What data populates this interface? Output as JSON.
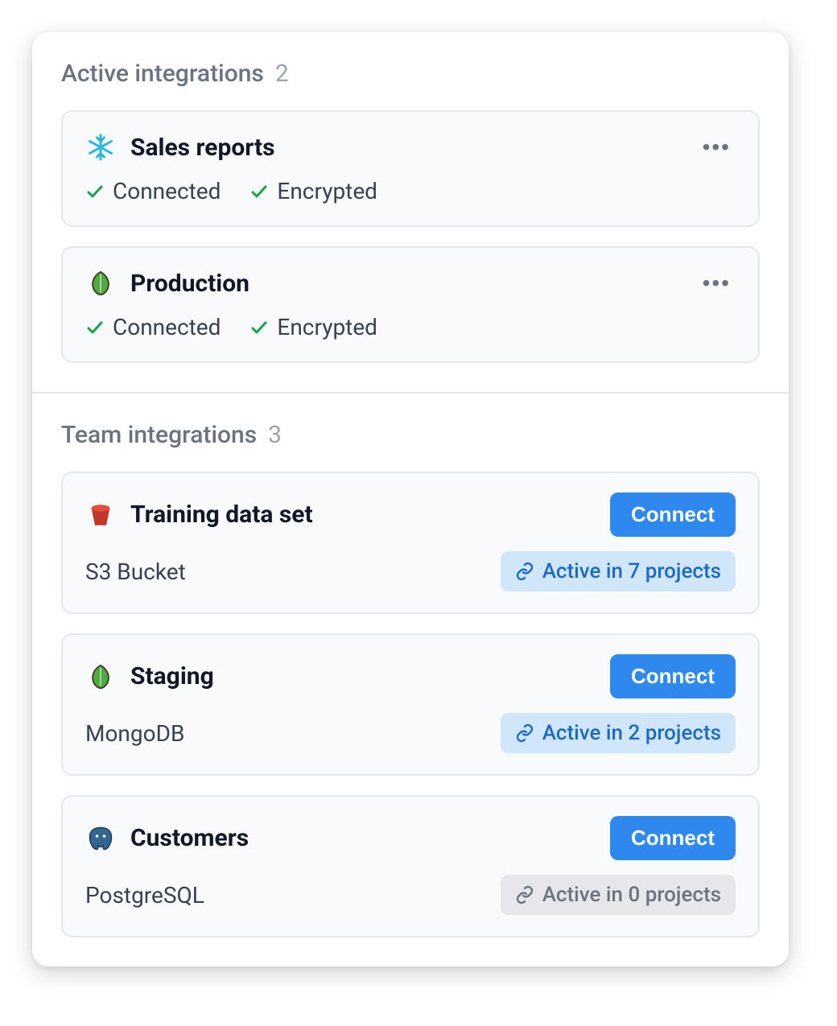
{
  "sections": {
    "active": {
      "title": "Active integrations",
      "count": "2",
      "items": [
        {
          "icon": "snowflake",
          "title": "Sales reports",
          "status1": "Connected",
          "status2": "Encrypted"
        },
        {
          "icon": "mongodb",
          "title": "Production",
          "status1": "Connected",
          "status2": "Encrypted"
        }
      ]
    },
    "team": {
      "title": "Team integrations",
      "count": "3",
      "items": [
        {
          "icon": "redshift",
          "title": "Training data set",
          "subtype": "S3 Bucket",
          "connect_label": "Connect",
          "badge_text": "Active in 7 projects",
          "badge_style": "blue"
        },
        {
          "icon": "mongodb",
          "title": "Staging",
          "subtype": "MongoDB",
          "connect_label": "Connect",
          "badge_text": "Active in 2 projects",
          "badge_style": "blue"
        },
        {
          "icon": "postgresql",
          "title": "Customers",
          "subtype": "PostgreSQL",
          "connect_label": "Connect",
          "badge_text": "Active in 0 projects",
          "badge_style": "gray"
        }
      ]
    }
  }
}
